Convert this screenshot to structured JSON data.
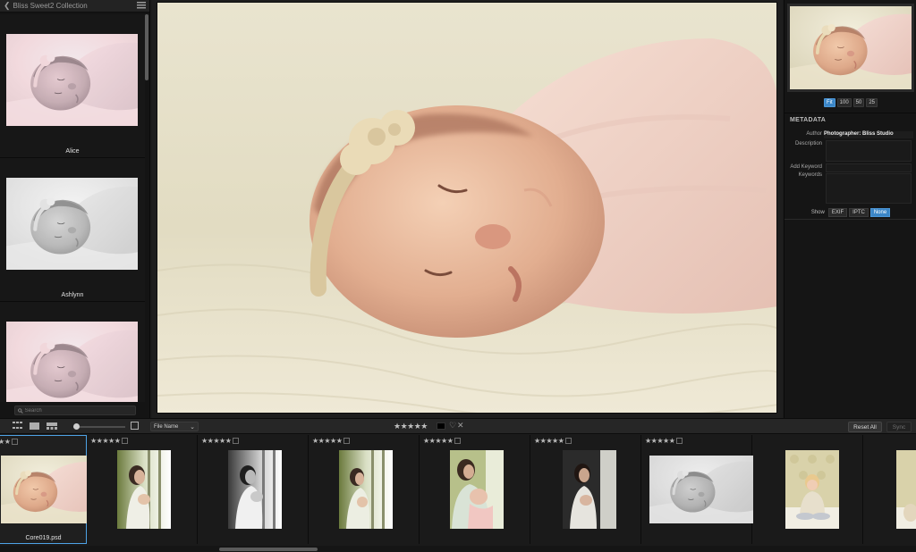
{
  "left_panel": {
    "title": "Bliss Sweet2 Collection",
    "back_icon": "chevron-left-icon",
    "menu_icon": "list-menu-icon",
    "presets": [
      {
        "name": "Alice",
        "tone": "mauve"
      },
      {
        "name": "Ashlynn",
        "tone": "gray"
      },
      {
        "name": "",
        "tone": "mauve"
      }
    ],
    "search": {
      "placeholder": "Search"
    }
  },
  "viewer": {
    "image": "sleeping-newborn-pink-wrap"
  },
  "right_panel": {
    "zoom_options": [
      "Fit",
      "100",
      "50",
      "25"
    ],
    "zoom_selected": "Fit",
    "metadata": {
      "heading": "METADATA",
      "author_label": "Author",
      "author_value": "Photographer: Bliss Studio",
      "description_label": "Description",
      "description_value": "",
      "add_keyword_label": "Add Keyword",
      "add_keyword_value": "",
      "keywords_label": "Keywords",
      "keywords_value": ""
    },
    "show": {
      "label": "Show",
      "options": [
        "EXIF",
        "IPTC",
        "None"
      ],
      "selected": "None"
    }
  },
  "toolbar": {
    "grid_icon": "grid-view-icon",
    "single_icon": "single-view-icon",
    "compare_icon": "compare-view-icon",
    "thumb_size_fraction": 0.0,
    "sort_value": "File Name",
    "stars": "★★★★★",
    "heart_icon": "heart-icon",
    "reject_icon": "reject-x-icon",
    "reset_label": "Reset All",
    "sync_label": "Sync"
  },
  "filmstrip": {
    "items": [
      {
        "stars": "★★★★★",
        "label": "Core019.psd",
        "selected": true,
        "kind": "newborn-color"
      },
      {
        "stars": "★★★★★",
        "label": "",
        "selected": false,
        "kind": "mother-window-color"
      },
      {
        "stars": "★★★★★",
        "label": "",
        "selected": false,
        "kind": "mother-window-bw"
      },
      {
        "stars": "★★★★★",
        "label": "",
        "selected": false,
        "kind": "mother-window-color"
      },
      {
        "stars": "★★★★★",
        "label": "",
        "selected": false,
        "kind": "mother-baby-color"
      },
      {
        "stars": "★★★★★",
        "label": "",
        "selected": false,
        "kind": "mother-dark-color"
      },
      {
        "stars": "★★★★★",
        "label": "",
        "selected": false,
        "kind": "newborn-bw"
      },
      {
        "stars": "",
        "label": "",
        "selected": false,
        "kind": "toddler-color"
      },
      {
        "stars": "",
        "label": "",
        "selected": false,
        "kind": "toddler-color"
      }
    ]
  }
}
